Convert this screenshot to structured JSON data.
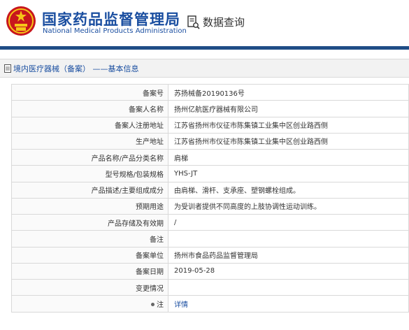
{
  "header": {
    "title_cn": "国家药品监督管理局",
    "title_en": "National Medical Products Administration",
    "query_label": "数据查询"
  },
  "section": {
    "title": "境内医疗器械（备案） ——基本信息"
  },
  "rows": [
    {
      "label": "备案号",
      "value": "苏扬械备20190136号"
    },
    {
      "label": "备案人名称",
      "value": "扬州亿航医疗器械有限公司"
    },
    {
      "label": "备案人注册地址",
      "value": "江苏省扬州市仪征市陈集镇工业集中区创业路西侧"
    },
    {
      "label": "生产地址",
      "value": "江苏省扬州市仪征市陈集镇工业集中区创业路西侧"
    },
    {
      "label": "产品名称/产品分类名称",
      "value": "肩梯"
    },
    {
      "label": "型号规格/包装规格",
      "value": "YHS-JT"
    },
    {
      "label": "产品描述/主要组成成分",
      "value": "由肩梯、滑杆、支承座、塑钢螺栓组成。"
    },
    {
      "label": "预期用途",
      "value": "为受训者提供不同高度的上肢协调性运动训练。"
    },
    {
      "label": "产品存储及有效期",
      "value": "/"
    },
    {
      "label": "备注",
      "value": ""
    },
    {
      "label": "备案单位",
      "value": "扬州市食品药品监督管理局"
    },
    {
      "label": "备案日期",
      "value": "2019-05-28"
    },
    {
      "label": "变更情况",
      "value": ""
    },
    {
      "label": "注",
      "value": "详情"
    }
  ],
  "colors": {
    "brand_blue": "#1a4ea0",
    "bar_blue": "#1f4d86",
    "emblem_red": "#c8161d",
    "emblem_gold": "#f5c518"
  },
  "icons": [
    "national-emblem-icon",
    "search-document-icon",
    "document-icon",
    "bullet-icon"
  ]
}
